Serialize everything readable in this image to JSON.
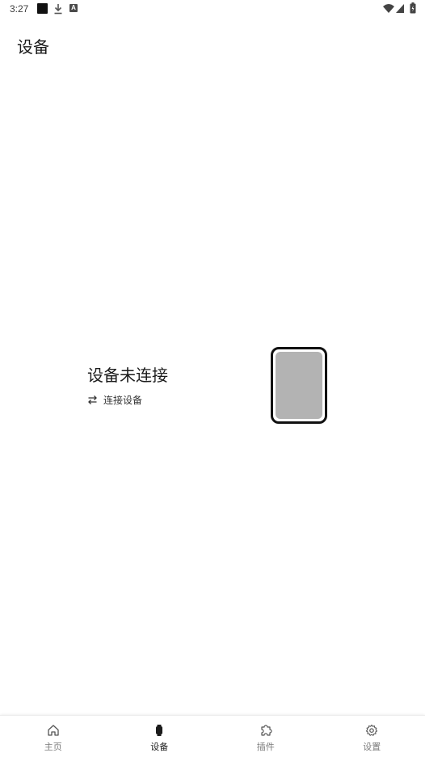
{
  "status_bar": {
    "time": "3:27",
    "notification_a_label": "A"
  },
  "header": {
    "title": "设备"
  },
  "device": {
    "status_title": "设备未连接",
    "connect_label": "连接设备",
    "screen_color": "#b3b3b3"
  },
  "bottom_nav": {
    "items": [
      {
        "label": "主页",
        "icon": "home-icon",
        "active": false
      },
      {
        "label": "设备",
        "icon": "watch-icon",
        "active": true
      },
      {
        "label": "插件",
        "icon": "puzzle-icon",
        "active": false
      },
      {
        "label": "设置",
        "icon": "gear-icon",
        "active": false
      }
    ]
  }
}
